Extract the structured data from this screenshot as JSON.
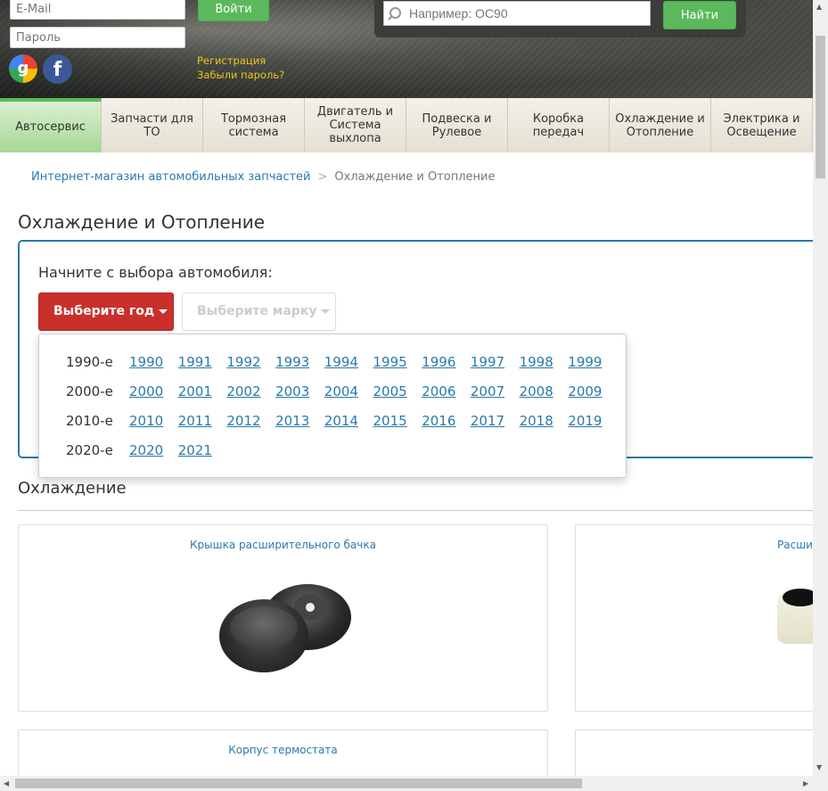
{
  "login": {
    "email_placeholder": "E-Mail",
    "password_placeholder": "Пароль",
    "login_button": "Войти",
    "register_link": "Регистрация",
    "forgot_link": "Забыли пароль?"
  },
  "social": {
    "google": "g",
    "facebook": "f"
  },
  "search": {
    "placeholder": "Например: OC90",
    "button": "Найти"
  },
  "nav": {
    "items": [
      {
        "label": "Автосервис",
        "active": true
      },
      {
        "label": "Запчасти для ТО"
      },
      {
        "label": "Тормозная система"
      },
      {
        "label": "Двигатель и Система выхлопа"
      },
      {
        "label": "Подвеска и Рулевое"
      },
      {
        "label": "Коробка передач"
      },
      {
        "label": "Охлаждение и Отопление"
      },
      {
        "label": "Электрика и Освещение"
      }
    ]
  },
  "breadcrumb": {
    "home": "Интернет-магазин автомобильных запчастей",
    "separator": ">",
    "current": "Охлаждение и Отопление"
  },
  "page_title": "Охлаждение и Отопление",
  "selector": {
    "heading": "Начните с выбора автомобиля:",
    "year_button": "Выберите год",
    "brand_button": "Выберите марку"
  },
  "years": {
    "decades": [
      {
        "label": "1990-е",
        "years": [
          "1990",
          "1991",
          "1992",
          "1993",
          "1994",
          "1995",
          "1996",
          "1997",
          "1998",
          "1999"
        ]
      },
      {
        "label": "2000-е",
        "years": [
          "2000",
          "2001",
          "2002",
          "2003",
          "2004",
          "2005",
          "2006",
          "2007",
          "2008",
          "2009"
        ]
      },
      {
        "label": "2010-е",
        "years": [
          "2010",
          "2011",
          "2012",
          "2013",
          "2014",
          "2015",
          "2016",
          "2017",
          "2018",
          "2019"
        ]
      },
      {
        "label": "2020-е",
        "years": [
          "2020",
          "2021"
        ]
      }
    ]
  },
  "section": {
    "title": "Охлаждение"
  },
  "products": [
    {
      "title": "Крышка расширительного бачка"
    },
    {
      "title": "Расшир"
    },
    {
      "title": "Корпус термостата"
    },
    {
      "title": ""
    }
  ],
  "colors": {
    "accent_green": "#5cb85c",
    "accent_red": "#c9302c",
    "link_blue": "#2a7aa8"
  }
}
